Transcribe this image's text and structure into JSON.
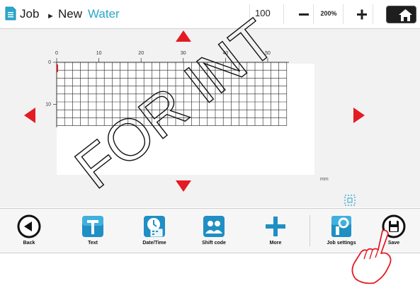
{
  "header": {
    "crumb_job": "Job",
    "crumb_separator": "►",
    "crumb_new": "New",
    "message_name": "Water",
    "zoom_value": "100",
    "zoom_percent": "200%",
    "icons": [
      "document-icon",
      "minus-icon",
      "plus-icon",
      "home-icon"
    ]
  },
  "canvas": {
    "ruler_x_ticks": [
      "0",
      "10",
      "20",
      "30",
      "40",
      "50"
    ],
    "ruler_y_ticks": [
      "0",
      "10"
    ],
    "unit_label": "mm",
    "arrows": [
      "arrow-up-icon",
      "arrow-down-icon",
      "arrow-left-icon",
      "arrow-right-icon"
    ],
    "colors": {
      "arrow": "#e31b23",
      "grid": "#222222",
      "cursor": "#e31b23"
    }
  },
  "toolbar": {
    "items": [
      {
        "label": "Back",
        "icon": "back-icon"
      },
      {
        "label": "Text",
        "icon": "text-icon"
      },
      {
        "label": "Date/Time",
        "icon": "date-time-icon"
      },
      {
        "label": "Shift code",
        "icon": "shift-code-icon"
      },
      {
        "label": "More",
        "icon": "plus-icon"
      },
      {
        "label": "Job settings",
        "icon": "job-settings-icon"
      },
      {
        "label": "Save",
        "icon": "save-icon"
      }
    ],
    "colors": {
      "accent": "#1f8fc4"
    }
  },
  "overlay": {
    "watermark_text": "FOR INT",
    "hand_icon": "pointing-hand-icon"
  }
}
